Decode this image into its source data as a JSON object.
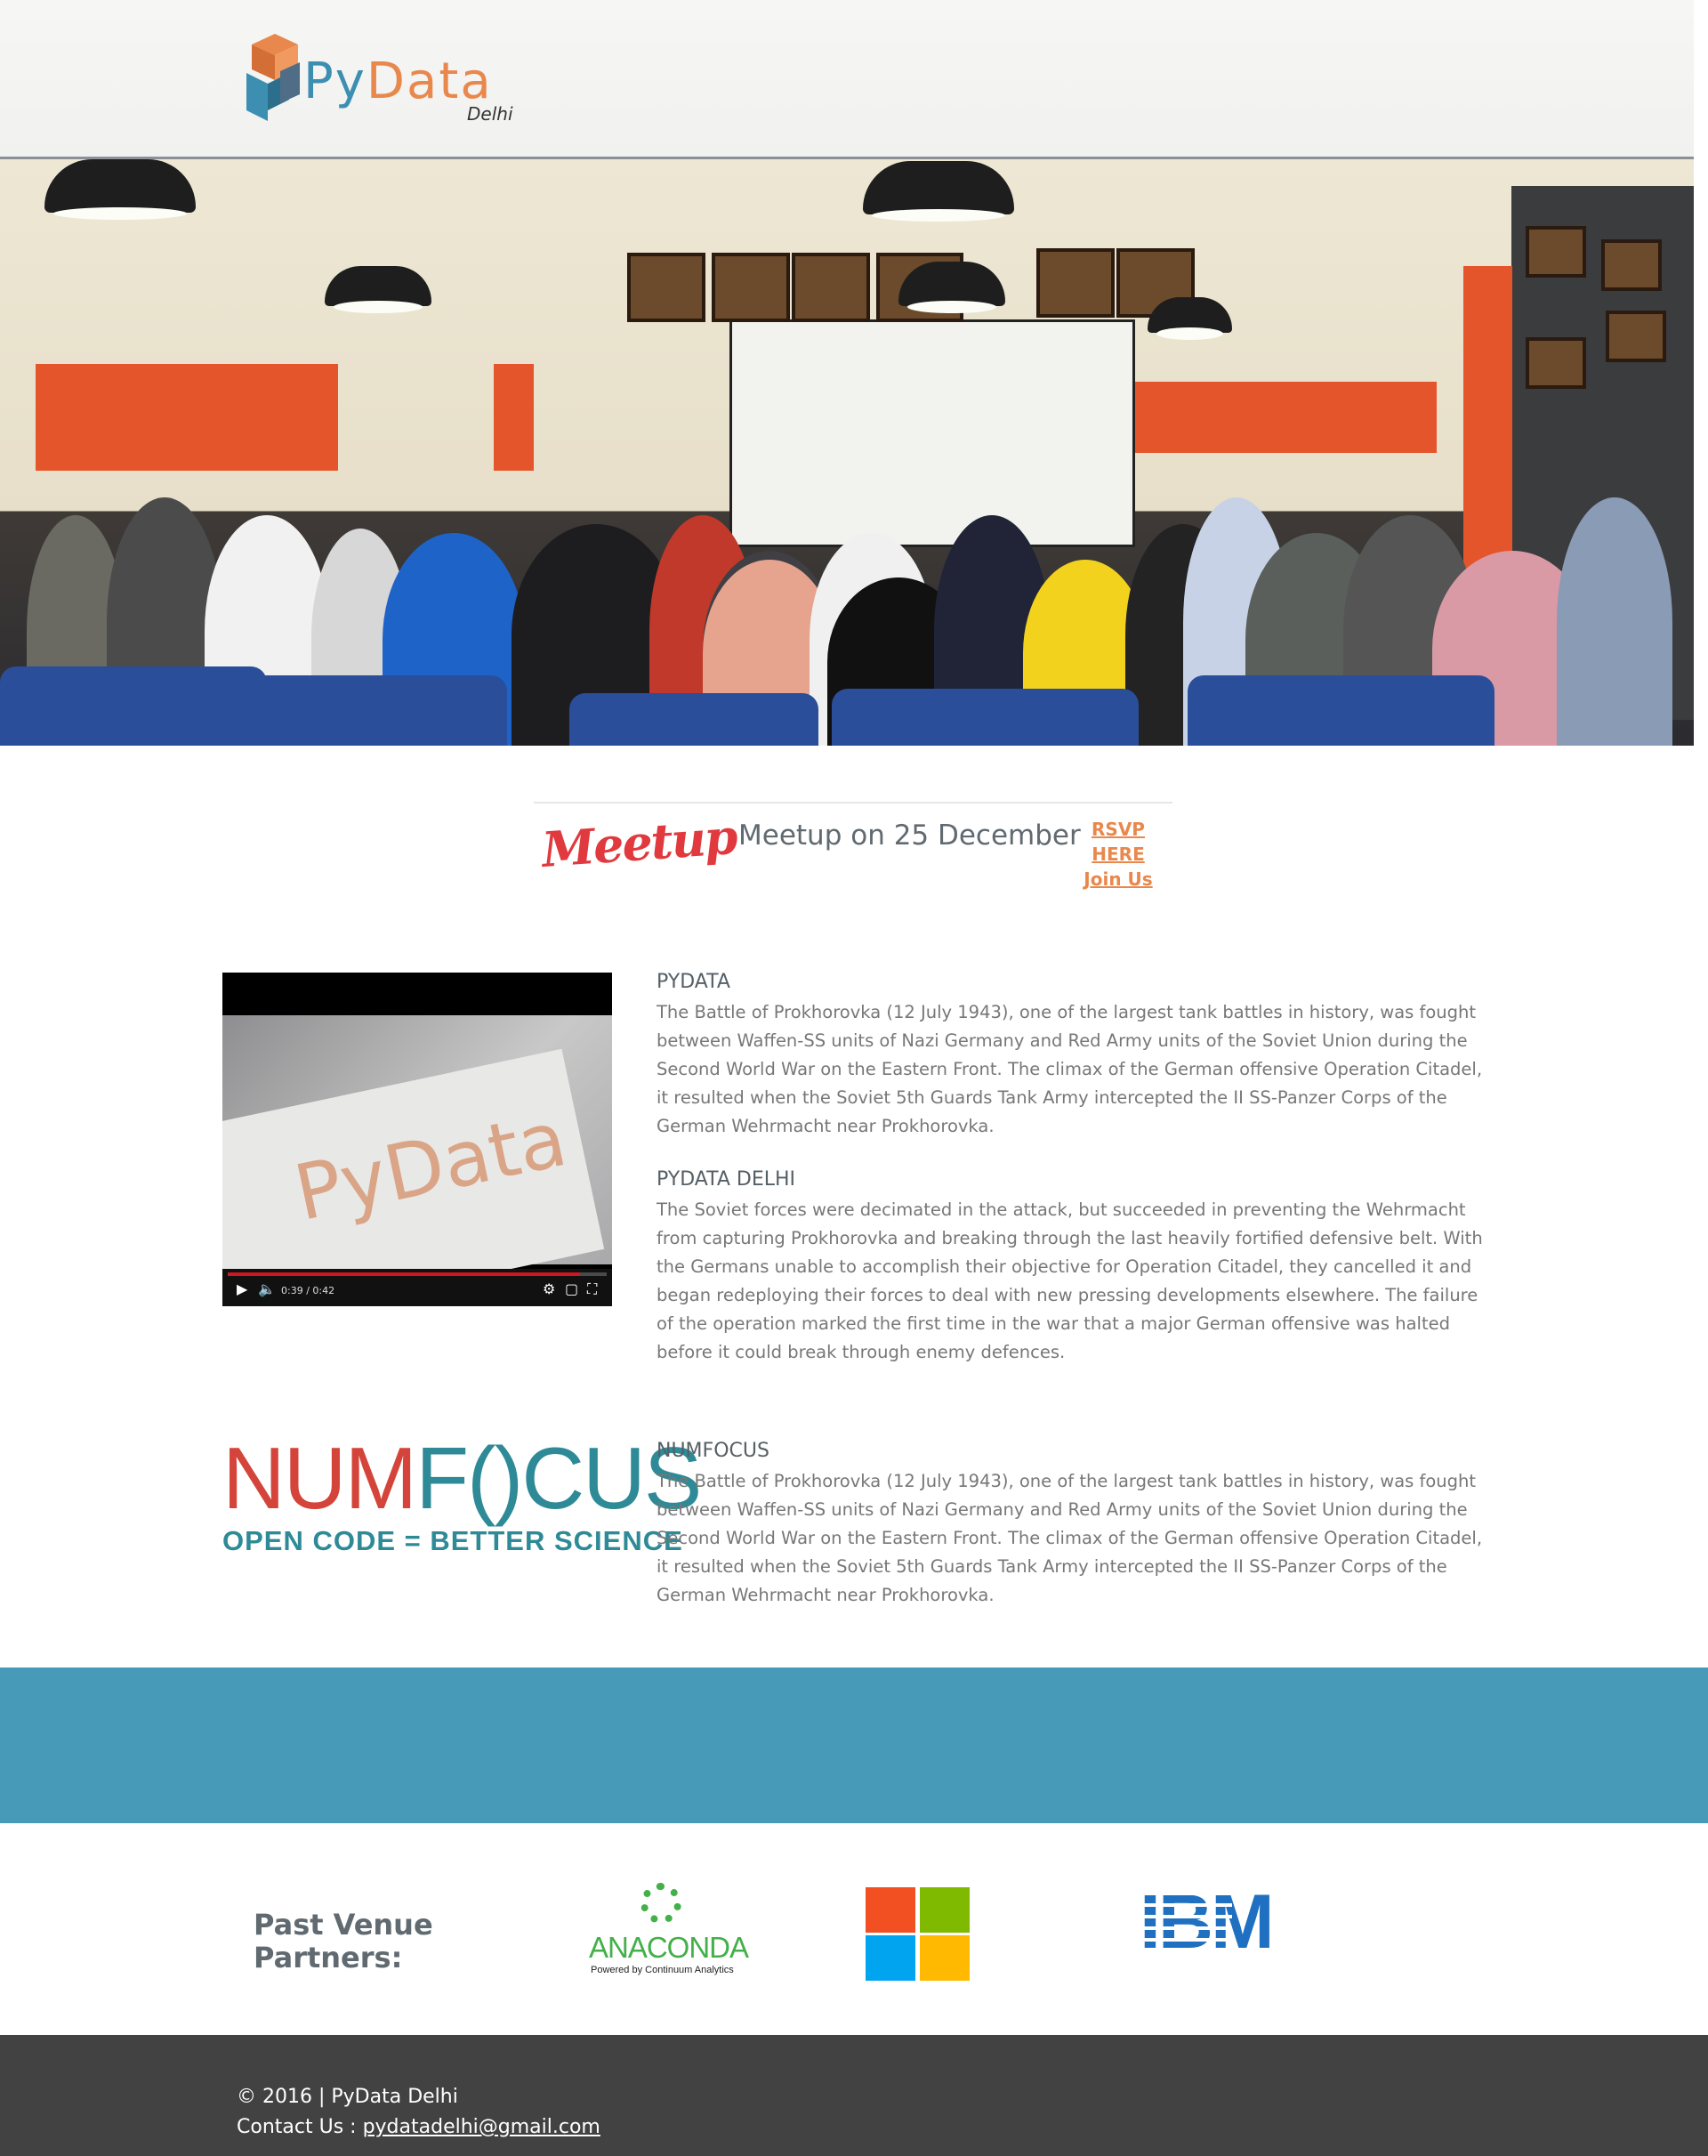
{
  "header": {
    "logo_word_py": "Py",
    "logo_word_data": "Data",
    "logo_subtitle": "Delhi"
  },
  "hero": {
    "icon": "group-photo"
  },
  "meetup": {
    "logo_text": "Meetup",
    "announcement": "Meetup on 25 December",
    "rsvp_label": "RSVP HERE",
    "join_label": "Join Us"
  },
  "video": {
    "time": "0:39 / 0:42",
    "progress": 0.93,
    "play_icon": "play-icon",
    "volume_icon": "volume-icon",
    "settings_icon": "gear-icon",
    "theater_icon": "theater-icon",
    "fullscreen_icon": "fullscreen-icon"
  },
  "sections": [
    {
      "title": "PYDATA",
      "body": "The Battle of Prokhorovka (12 July 1943), one of the largest tank battles in history, was fought between Waffen-SS units of Nazi Germany and Red Army units of the Soviet Union during the Second World War on the Eastern Front. The climax of the German offensive Operation Citadel, it resulted when the Soviet 5th Guards Tank Army intercepted the II SS-Panzer Corps of the German Wehrmacht near Prokhorovka."
    },
    {
      "title": "PYDATA DELHI",
      "body": "The Soviet forces were decimated in the attack, but succeeded in preventing the Wehrmacht from capturing Prokhorovka and breaking through the last heavily fortified defensive belt. With the Germans unable to accomplish their objective for Operation Citadel, they cancelled it and began redeploying their forces to deal with new pressing developments elsewhere. The failure of the operation marked the first time in the war that a major German offensive was halted before it could break through enemy defences."
    },
    {
      "title": "NUMFOCUS",
      "body": "The Battle of Prokhorovka (12 July 1943), one of the largest tank battles in history, was fought between Waffen-SS units of Nazi Germany and Red Army units of the Soviet Union during the Second World War on the Eastern Front. The climax of the German offensive Operation Citadel, it resulted when the Soviet 5th Guards Tank Army intercepted the II SS-Panzer Corps of the German Wehrmacht near Prokhorovka."
    }
  ],
  "numfocus_logo": {
    "word_num": "NUM",
    "word_focus": "F()CUS",
    "tagline": "OPEN CODE = BETTER SCIENCE"
  },
  "partners": {
    "title_line1": "Past Venue",
    "title_line2": "Partners:",
    "anaconda_word": "ANACONDA",
    "anaconda_sub": "Powered by Continuum Analytics",
    "ibm_word": "IBM",
    "ms_colors": [
      "#f25022",
      "#7fba00",
      "#00a4ef",
      "#ffb900"
    ]
  },
  "footer": {
    "copyright": "© 2016 | PyData Delhi",
    "contact_label": "Contact Us : ",
    "email": "pydatadelhi@gmail.com"
  },
  "colors": {
    "accent_orange": "#e9884c",
    "accent_blue": "#3d8fb1",
    "band_blue": "#489bb8",
    "footer_bg": "#424242"
  }
}
